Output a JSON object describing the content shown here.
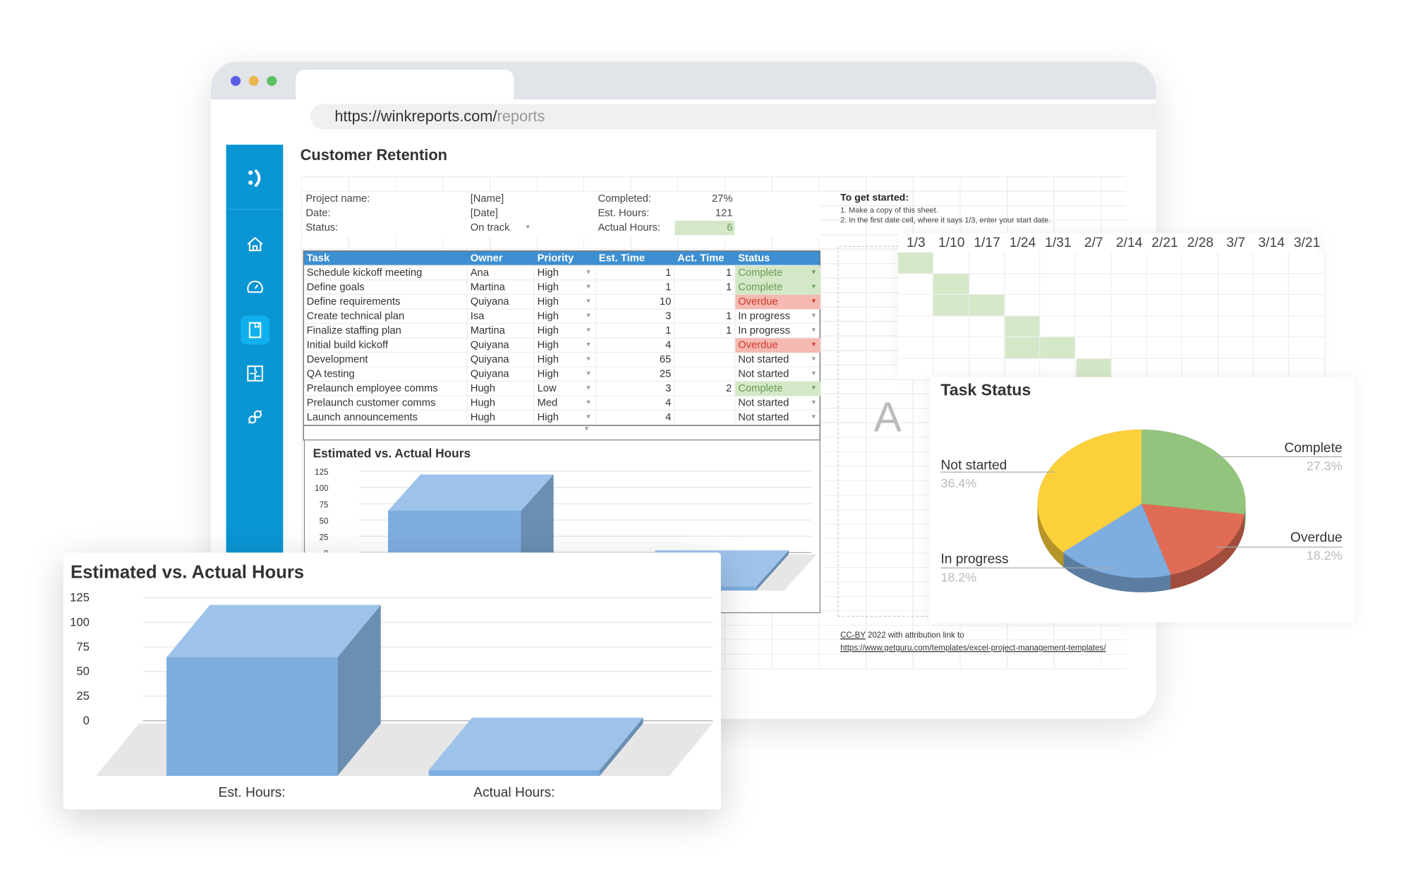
{
  "browser": {
    "dots": [
      "#5b5ce6",
      "#e8b84f",
      "#5cbf62"
    ],
    "url_base": "https://winkreports.com/",
    "url_path": "reports"
  },
  "sidebar": {
    "color": "#0a95d3",
    "logo": "wink-logo",
    "items": [
      {
        "icon": "home-icon"
      },
      {
        "icon": "dashboard-gauge-icon"
      },
      {
        "icon": "report-book-icon",
        "active": true
      },
      {
        "icon": "integrations-puzzle-icon"
      },
      {
        "icon": "link-plug-icon"
      }
    ]
  },
  "page": {
    "title": "Customer Retention"
  },
  "info": {
    "project_name_label": "Project name:",
    "project_name": "[Name]",
    "date_label": "Date:",
    "date": "[Date]",
    "status_label": "Status:",
    "status": "On track",
    "completed_label": "Completed:",
    "completed": "27%",
    "est_hours_label": "Est. Hours:",
    "est_hours": "121",
    "actual_hours_label": "Actual Hours:",
    "actual_hours": "6"
  },
  "table": {
    "columns": [
      "Task",
      "Owner",
      "Priority",
      "Est. Time",
      "Act. Time",
      "Status"
    ],
    "rows": [
      [
        "Schedule kickoff meeting",
        "Ana",
        "High",
        "1",
        "1",
        "Complete"
      ],
      [
        "Define goals",
        "Martina",
        "High",
        "1",
        "1",
        "Complete"
      ],
      [
        "Define requirements",
        "Quiyana",
        "High",
        "10",
        "",
        "Overdue"
      ],
      [
        "Create technical plan",
        "Isa",
        "High",
        "3",
        "1",
        "In progress"
      ],
      [
        "Finalize staffing plan",
        "Martina",
        "High",
        "1",
        "1",
        "In progress"
      ],
      [
        "Initial build kickoff",
        "Quiyana",
        "High",
        "4",
        "",
        "Overdue"
      ],
      [
        "Development",
        "Quiyana",
        "High",
        "65",
        "",
        "Not started"
      ],
      [
        "QA testing",
        "Quiyana",
        "High",
        "25",
        "",
        "Not started"
      ],
      [
        "Prelaunch employee comms",
        "Hugh",
        "Low",
        "3",
        "2",
        "Complete"
      ],
      [
        "Prelaunch customer comms",
        "Hugh",
        "Med",
        "4",
        "",
        "Not started"
      ],
      [
        "Launch announcements",
        "Hugh",
        "High",
        "4",
        "",
        "Not started"
      ]
    ]
  },
  "instructions": {
    "title": "To get started:",
    "lines": [
      "1. Make a copy of this sheet.",
      "2. In the first date cell, where it says 1/3, enter your start date."
    ]
  },
  "gantt": {
    "dates": [
      "1/3",
      "1/10",
      "1/17",
      "1/24",
      "1/31",
      "2/7",
      "2/14",
      "2/21",
      "2/28",
      "3/7",
      "3/14",
      "3/21"
    ],
    "filled_weeks": [
      [
        0
      ],
      [
        1
      ],
      [
        1,
        2
      ],
      [
        3
      ],
      [
        3,
        4
      ],
      [
        5
      ]
    ],
    "fill_color": "#d4e8c8"
  },
  "partial_letter": "A",
  "footer": {
    "license": "CC-BY",
    "text": " 2022 with attribution link to",
    "link": "https://www.getguru.com/templates/excel-project-management-templates/"
  },
  "chart_data": [
    {
      "type": "pie",
      "title": "Task Status",
      "slices": [
        {
          "label": "Complete",
          "value": 27.3,
          "pct": "27.3%",
          "color": "#93c47d"
        },
        {
          "label": "Overdue",
          "value": 18.2,
          "pct": "18.2%",
          "color": "#e06c55"
        },
        {
          "label": "In progress",
          "value": 18.2,
          "pct": "18.2%",
          "color": "#7eaee0"
        },
        {
          "label": "Not started",
          "value": 36.4,
          "pct": "36.4%",
          "color": "#fcd03b"
        }
      ]
    },
    {
      "type": "bar",
      "title": "Estimated vs. Actual Hours",
      "categories": [
        "Est. Hours:",
        "Actual Hours:"
      ],
      "values": [
        121,
        6
      ],
      "yticks": [
        "125",
        "100",
        "75",
        "50",
        "25",
        "0"
      ],
      "ylim": [
        0,
        125
      ],
      "color": "#7eaee0"
    }
  ]
}
